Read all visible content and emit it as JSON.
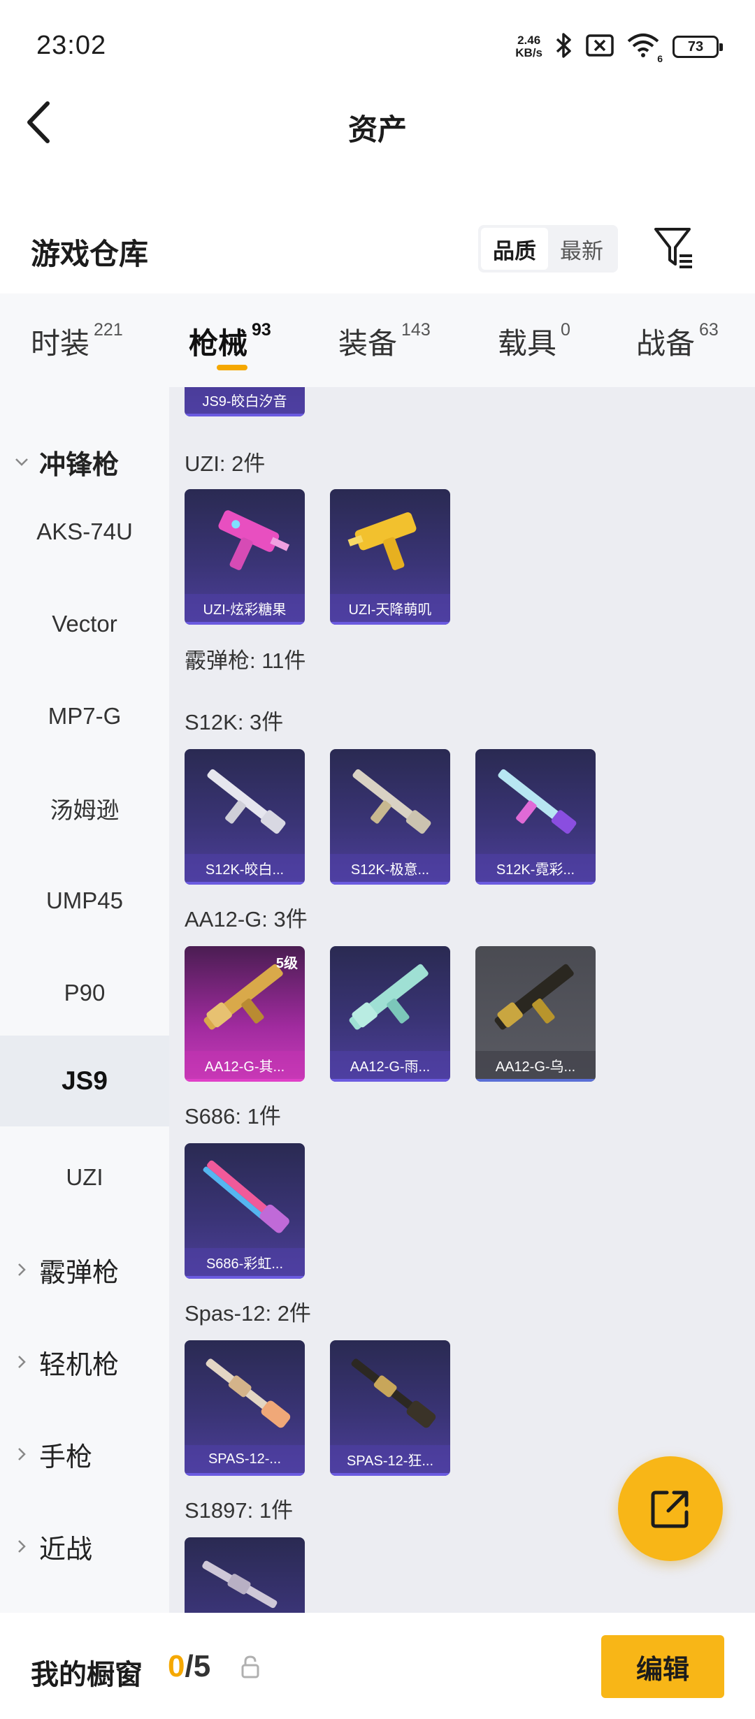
{
  "status_bar": {
    "time": "23:02",
    "net_speed_value": "2.46",
    "net_speed_unit": "KB/s",
    "battery": "73",
    "wifi_label": "6"
  },
  "header": {
    "title": "资产"
  },
  "warehouse": {
    "title": "游戏仓库",
    "sort_quality": "品质",
    "sort_latest": "最新"
  },
  "tabs": [
    {
      "label": "时装",
      "count": "221"
    },
    {
      "label": "枪械",
      "count": "93"
    },
    {
      "label": "装备",
      "count": "143"
    },
    {
      "label": "载具",
      "count": "0"
    },
    {
      "label": "战备",
      "count": "63"
    }
  ],
  "sidebar": {
    "expanded_category": "冲锋枪",
    "sub_items": [
      "AKS-74U",
      "Vector",
      "MP7-G",
      "汤姆逊",
      "UMP45",
      "P90",
      "JS9",
      "UZI"
    ],
    "collapsed_categories": [
      "霰弹枪",
      "轻机枪",
      "手枪",
      "近战"
    ]
  },
  "content": {
    "top_partial_card": "JS9-皎白汐音",
    "groups": [
      {
        "label": "UZI: 2件",
        "items": [
          {
            "name": "UZI-炫彩糖果"
          },
          {
            "name": "UZI-天降萌叽"
          }
        ]
      },
      {
        "label": "霰弹枪: 11件"
      },
      {
        "label": "S12K: 3件",
        "items": [
          {
            "name": "S12K-皎白..."
          },
          {
            "name": "S12K-极意..."
          },
          {
            "name": "S12K-霓彩..."
          }
        ]
      },
      {
        "label": "AA12-G: 3件",
        "items": [
          {
            "name": "AA12-G-其...",
            "level": "5级"
          },
          {
            "name": "AA12-G-雨..."
          },
          {
            "name": "AA12-G-乌..."
          }
        ]
      },
      {
        "label": "S686: 1件",
        "items": [
          {
            "name": "S686-彩虹..."
          }
        ]
      },
      {
        "label": "Spas-12: 2件",
        "items": [
          {
            "name": "SPAS-12-..."
          },
          {
            "name": "SPAS-12-狂..."
          }
        ]
      },
      {
        "label": "S1897: 1件"
      }
    ]
  },
  "bottom_bar": {
    "showcase_label": "我的橱窗",
    "used": "0",
    "separator_total": "/5",
    "edit_label": "编辑"
  },
  "colors": {
    "accent": "#f8b617",
    "underline": "#f5a800",
    "content_bg": "#ecedf2"
  }
}
